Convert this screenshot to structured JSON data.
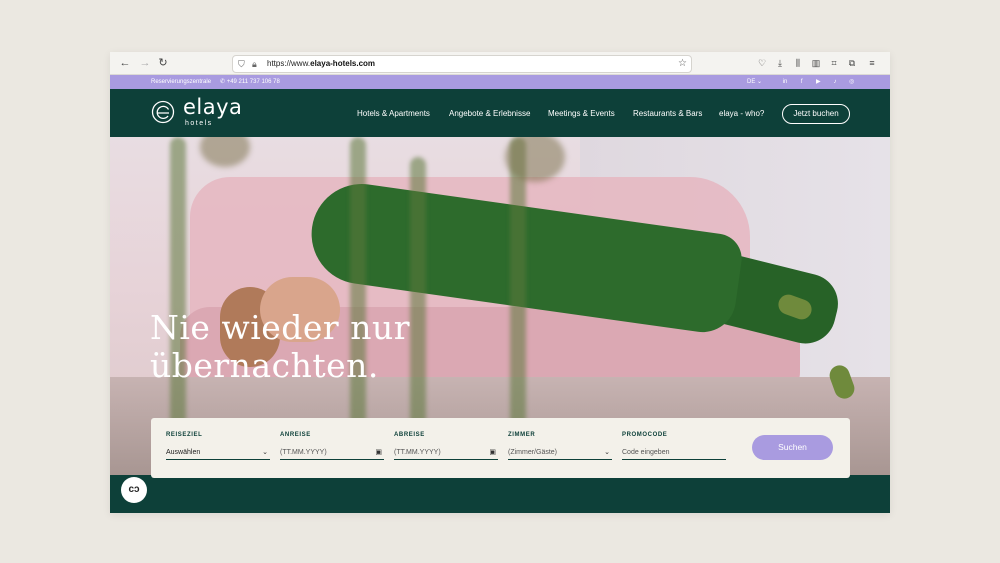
{
  "browser": {
    "url_scheme": "https://www.",
    "url_host": "elaya-hotels.com",
    "icons": [
      "back-icon",
      "forward-icon",
      "reload-icon",
      "shield-icon",
      "lock-icon",
      "star-icon",
      "pocket-icon",
      "download-icon",
      "library-icon",
      "sidebar-icon",
      "screenshot-icon",
      "extensions-icon",
      "menu-icon"
    ]
  },
  "utility": {
    "reservation_label": "Reservierungszentrale",
    "phone": "+49 211 737 106 78",
    "language": "DE",
    "socials": [
      "linkedin-icon",
      "facebook-icon",
      "youtube-icon",
      "tiktok-icon",
      "instagram-icon"
    ]
  },
  "header": {
    "logo_word": "elaya",
    "logo_sub": "hotels",
    "nav": [
      "Hotels & Apartments",
      "Angebote & Erlebnisse",
      "Meetings & Events",
      "Restaurants & Bars",
      "elaya - who?"
    ],
    "cta": "Jetzt buchen"
  },
  "hero": {
    "headline_line1": "Nie wieder nur",
    "headline_line2": "übernachten."
  },
  "booking": {
    "destination_label": "REISEZIEL",
    "destination_value": "Auswählen",
    "arrival_label": "ANREISE",
    "arrival_placeholder": "(TT.MM.YYYY)",
    "departure_label": "ABREISE",
    "departure_placeholder": "(TT.MM.YYYY)",
    "rooms_label": "ZIMMER",
    "rooms_placeholder": "(Zimmer/Gäste)",
    "promo_label": "PROMOCODE",
    "promo_placeholder": "Code eingeben",
    "search_button": "Suchen"
  },
  "colors": {
    "brand_green": "#0d4039",
    "accent_lavender": "#a99be0",
    "booking_bg": "#f3f1ea"
  }
}
